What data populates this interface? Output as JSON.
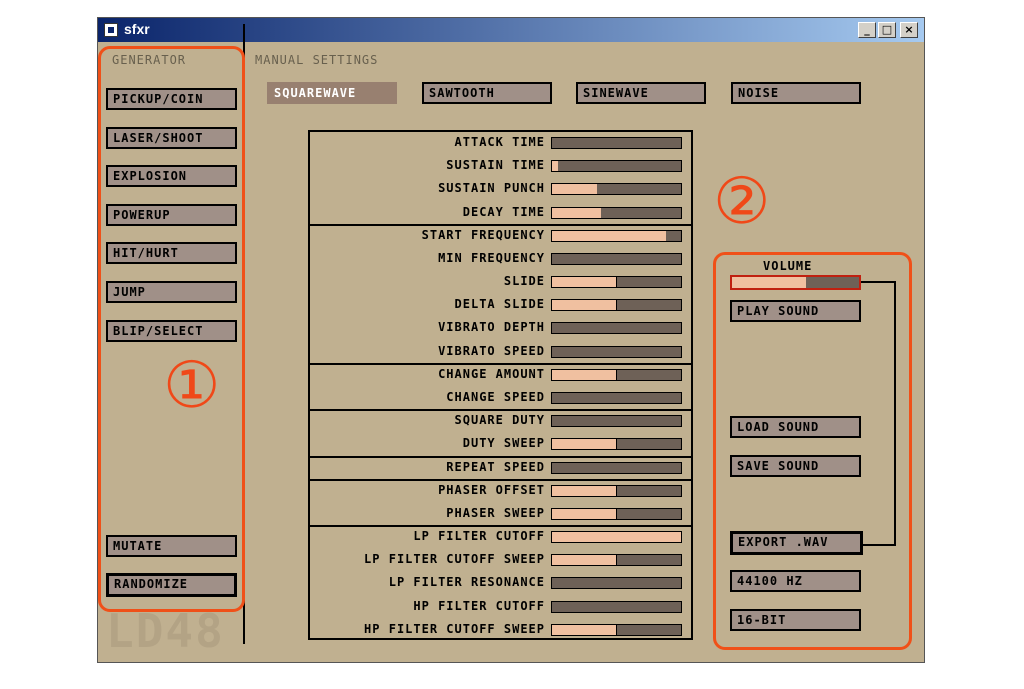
{
  "window": {
    "title": "sfxr",
    "controls": [
      "_",
      "□",
      "×"
    ]
  },
  "generator": {
    "title": "GENERATOR",
    "buttons": [
      "PICKUP/COIN",
      "LASER/SHOOT",
      "EXPLOSION",
      "POWERUP",
      "HIT/HURT",
      "JUMP",
      "BLIP/SELECT"
    ],
    "mutate": "MUTATE",
    "randomize": "RANDOMIZE"
  },
  "manual": {
    "title": "MANUAL SETTINGS",
    "waves": [
      "SQUAREWAVE",
      "SAWTOOTH",
      "SINEWAVE",
      "NOISE"
    ],
    "selected_wave": "SQUAREWAVE"
  },
  "params": [
    {
      "name": "ATTACK TIME",
      "value": 0.0,
      "bipolar": false
    },
    {
      "name": "SUSTAIN TIME",
      "value": 0.05,
      "bipolar": false
    },
    {
      "name": "SUSTAIN PUNCH",
      "value": 0.35,
      "bipolar": false
    },
    {
      "name": "DECAY TIME",
      "value": 0.38,
      "bipolar": false
    },
    {
      "name": "START FREQUENCY",
      "value": 0.88,
      "bipolar": false
    },
    {
      "name": "MIN FREQUENCY",
      "value": 0.0,
      "bipolar": false
    },
    {
      "name": "SLIDE",
      "value": 0.0,
      "bipolar": true
    },
    {
      "name": "DELTA SLIDE",
      "value": 0.0,
      "bipolar": true
    },
    {
      "name": "VIBRATO DEPTH",
      "value": 0.0,
      "bipolar": false
    },
    {
      "name": "VIBRATO SPEED",
      "value": 0.0,
      "bipolar": false
    },
    {
      "name": "CHANGE AMOUNT",
      "value": 0.0,
      "bipolar": true
    },
    {
      "name": "CHANGE SPEED",
      "value": 0.0,
      "bipolar": false
    },
    {
      "name": "SQUARE DUTY",
      "value": 0.0,
      "bipolar": false
    },
    {
      "name": "DUTY SWEEP",
      "value": 0.0,
      "bipolar": true
    },
    {
      "name": "REPEAT SPEED",
      "value": 0.0,
      "bipolar": false
    },
    {
      "name": "PHASER OFFSET",
      "value": 0.0,
      "bipolar": true
    },
    {
      "name": "PHASER SWEEP",
      "value": 0.0,
      "bipolar": true
    },
    {
      "name": "LP FILTER CUTOFF",
      "value": 1.0,
      "bipolar": false
    },
    {
      "name": "LP FILTER CUTOFF SWEEP",
      "value": 0.0,
      "bipolar": true
    },
    {
      "name": "LP FILTER RESONANCE",
      "value": 0.0,
      "bipolar": false
    },
    {
      "name": "HP FILTER CUTOFF",
      "value": 0.0,
      "bipolar": false
    },
    {
      "name": "HP FILTER CUTOFF SWEEP",
      "value": 0.0,
      "bipolar": true
    }
  ],
  "output": {
    "volume_label": "VOLUME",
    "volume_level": 0.58,
    "play": "PLAY SOUND",
    "load": "LOAD SOUND",
    "save": "SAVE SOUND",
    "export": "EXPORT .WAV",
    "rate": "44100 HZ",
    "bits": "16-BIT"
  },
  "annotations": {
    "one": "①",
    "two": "②"
  },
  "logo": "LD48",
  "colors": {
    "panel": "#c0b090",
    "slider_bg": "#6e6157",
    "slider_fill": "#f0c0a0",
    "annotation": "#f05018"
  }
}
